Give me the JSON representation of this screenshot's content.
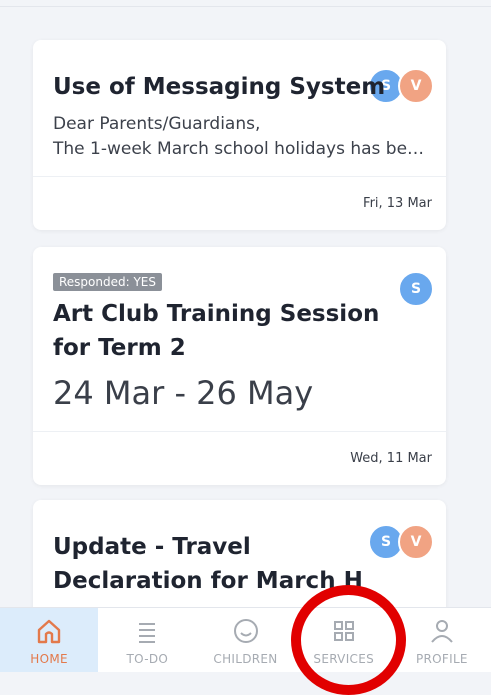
{
  "feed": {
    "cards": [
      {
        "title": "Use of Messaging System",
        "body_line1": "Dear Parents/Guardians,",
        "body_line2": "The 1-week March school holidays has be…",
        "date": "Fri, 13 Mar",
        "avatars": [
          "S",
          "V"
        ]
      },
      {
        "badge": "Responded: YES",
        "title_line1": "Art Club Training Session",
        "title_line2": "for Term 2",
        "date_range": "24 Mar - 26 May",
        "date": "Wed, 11 Mar",
        "avatars": [
          "S"
        ]
      },
      {
        "title_line1": "Update - Travel",
        "title_line2": "Declaration for March H",
        "avatars": [
          "S",
          "V"
        ]
      }
    ]
  },
  "nav": {
    "items": [
      {
        "label": "HOME",
        "icon": "home-icon",
        "active": true
      },
      {
        "label": "TO-DO",
        "icon": "list-icon"
      },
      {
        "label": "CHILDREN",
        "icon": "smiley-icon"
      },
      {
        "label": "SERVICES",
        "icon": "grid-icon"
      },
      {
        "label": "PROFILE",
        "icon": "person-icon"
      }
    ]
  },
  "colors": {
    "accent": "#e3794b",
    "active_bg": "#dcecfb",
    "avatar_s": "#69a8ee",
    "avatar_v": "#f1a383",
    "highlight": "#e10000"
  }
}
